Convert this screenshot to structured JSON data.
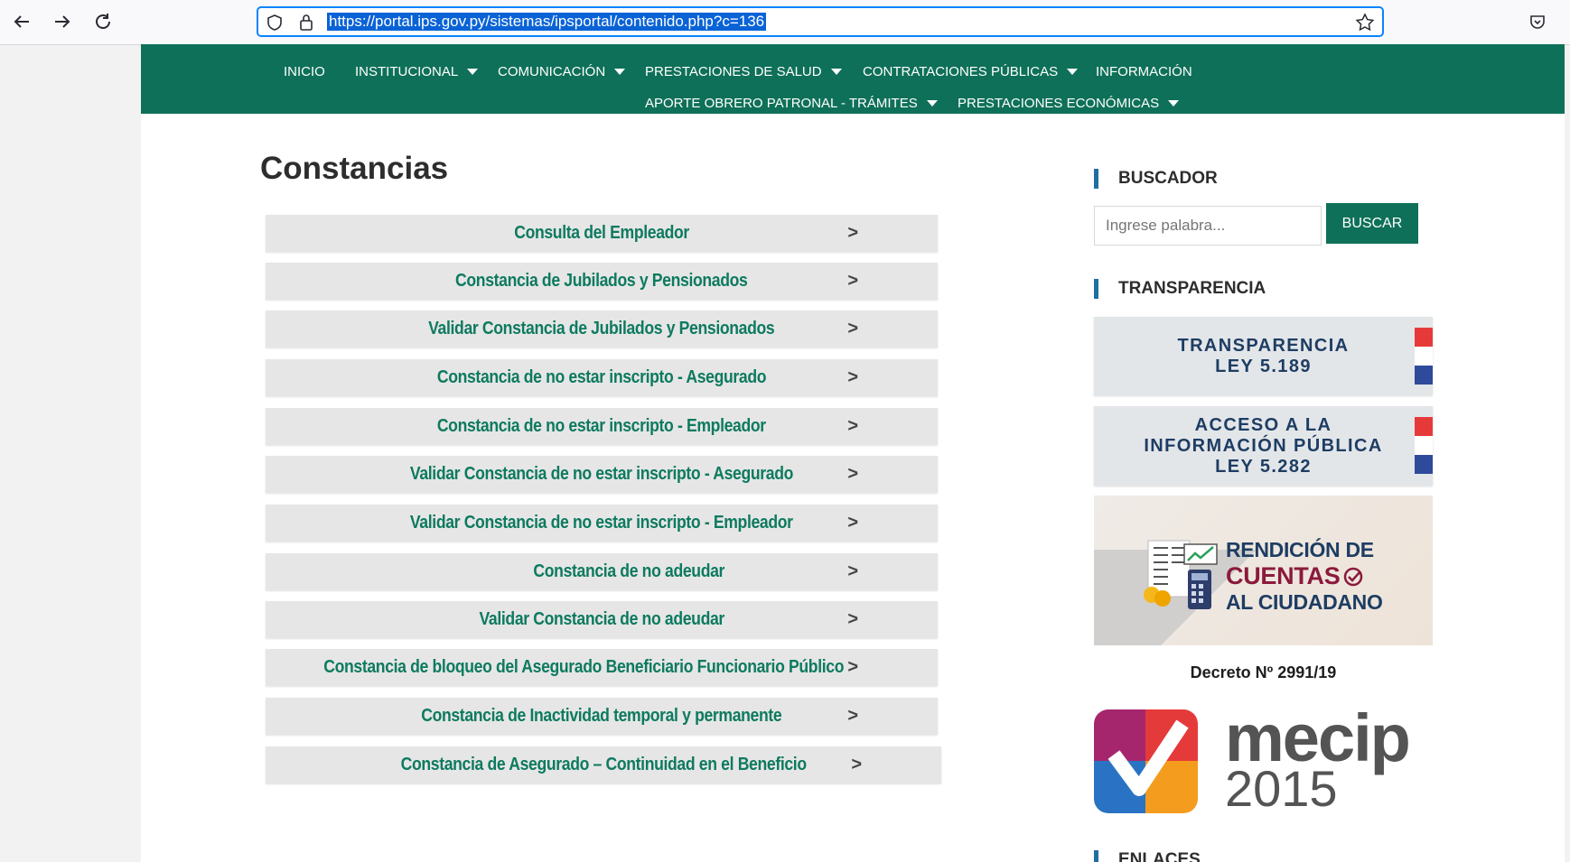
{
  "browser": {
    "url": "https://portal.ips.gov.py/sistemas/ipsportal/contenido.php?c=136",
    "back_icon": "arrow-left-icon",
    "forward_icon": "arrow-right-icon",
    "reload_icon": "reload-icon"
  },
  "nav": {
    "row1": [
      {
        "label": "INICIO",
        "dropdown": false
      },
      {
        "label": "INSTITUCIONAL",
        "dropdown": true
      },
      {
        "label": "COMUNICACIÓN",
        "dropdown": true
      },
      {
        "label": "PRESTACIONES DE SALUD",
        "dropdown": true
      },
      {
        "label": "CONTRATACIONES PÚBLICAS",
        "dropdown": true
      },
      {
        "label": "INFORMACIÓN",
        "dropdown": false
      }
    ],
    "row2": [
      {
        "label": "APORTE OBRERO PATRONAL - TRÁMITES",
        "dropdown": true
      },
      {
        "label": "PRESTACIONES ECONÓMICAS",
        "dropdown": true
      }
    ]
  },
  "main": {
    "title": "Constancias",
    "arrow": ">",
    "links": [
      "Consulta del Empleador",
      "Constancia de Jubilados y Pensionados",
      "Validar Constancia de Jubilados y Pensionados",
      "Constancia de no estar inscripto - Asegurado",
      "Constancia de no estar inscripto - Empleador",
      "Validar Constancia de no estar inscripto - Asegurado",
      "Validar Constancia de no estar inscripto - Empleador",
      "Constancia de no adeudar",
      "Validar Constancia de no adeudar",
      "Constancia de bloqueo del Asegurado Beneficiario Funcionario Público",
      "Constancia de Inactividad temporal y permanente",
      "Constancia de Asegurado – Continuidad en el Beneficio"
    ]
  },
  "sidebar": {
    "buscador": {
      "heading": "BUSCADOR",
      "placeholder": "Ingrese palabra...",
      "button": "BUSCAR"
    },
    "transparencia": {
      "heading": "TRANSPARENCIA",
      "banner1": "TRANSPARENCIA\nLEY 5.189",
      "banner2": "ACCESO A LA\nINFORMACIÓN PÚBLICA\nLEY 5.282"
    },
    "rendicion": {
      "line1": "RENDICIÓN DE",
      "line2": "CUENTAS",
      "line3": "AL CIUDADANO"
    },
    "decreto": "Decreto Nº 2991/19",
    "mecip": {
      "name": "mecip",
      "year": "2015"
    },
    "enlaces": "ENLACES"
  },
  "colors": {
    "nav_bg": "#0e7058",
    "link_text": "#0d7a5f",
    "banner_text": "#1e3d63",
    "rendicion_red": "#8b1a3c"
  }
}
